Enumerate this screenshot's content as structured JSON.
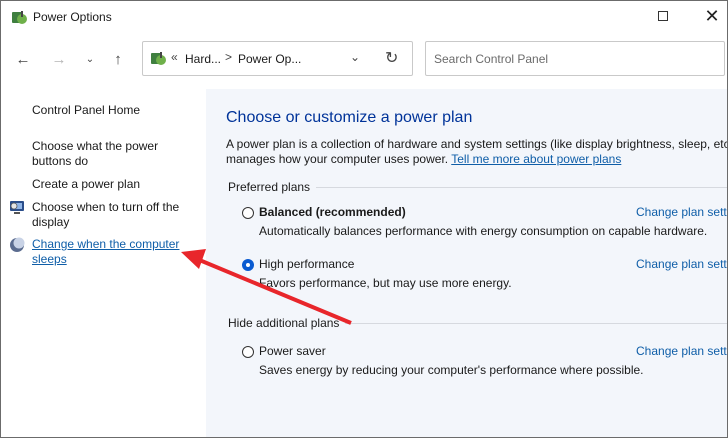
{
  "window": {
    "title": "Power Options"
  },
  "nav": {
    "back_icon": "arrow-left-icon",
    "forward_icon": "arrow-right-icon",
    "recent_icon": "chevron-down-icon",
    "up_icon": "arrow-up-icon"
  },
  "address": {
    "overflow": "«",
    "crumb1": "Hard...",
    "sep": ">",
    "crumb2": "Power Op..."
  },
  "search": {
    "placeholder": "Search Control Panel"
  },
  "sidebar": {
    "home": "Control Panel Home",
    "items": [
      {
        "label": "Choose what the power buttons do"
      },
      {
        "label": "Create a power plan"
      },
      {
        "label": "Choose when to turn off the display"
      },
      {
        "label": "Change when the computer sleeps"
      }
    ]
  },
  "main": {
    "heading": "Choose or customize a power plan",
    "desc_line1": "A power plan is a collection of hardware and system settings (like display brightness, sleep, etc.)",
    "desc_line2": "manages how your computer uses power. ",
    "desc_link": "Tell me more about power plans",
    "preferred_label": "Preferred plans",
    "hide_label": "Hide additional plans",
    "change_label": "Change plan setti",
    "plans": [
      {
        "name": "Balanced (recommended)",
        "desc": "Automatically balances performance with energy consumption on capable hardware.",
        "selected": false
      },
      {
        "name": "High performance",
        "desc": "Favors performance, but may use more energy.",
        "selected": true
      },
      {
        "name": "Power saver",
        "desc": "Saves energy by reducing your computer's performance where possible.",
        "selected": false
      }
    ]
  },
  "colors": {
    "annotation_arrow": "#e8262b",
    "heading": "#003399",
    "link": "#0f5ea8"
  }
}
